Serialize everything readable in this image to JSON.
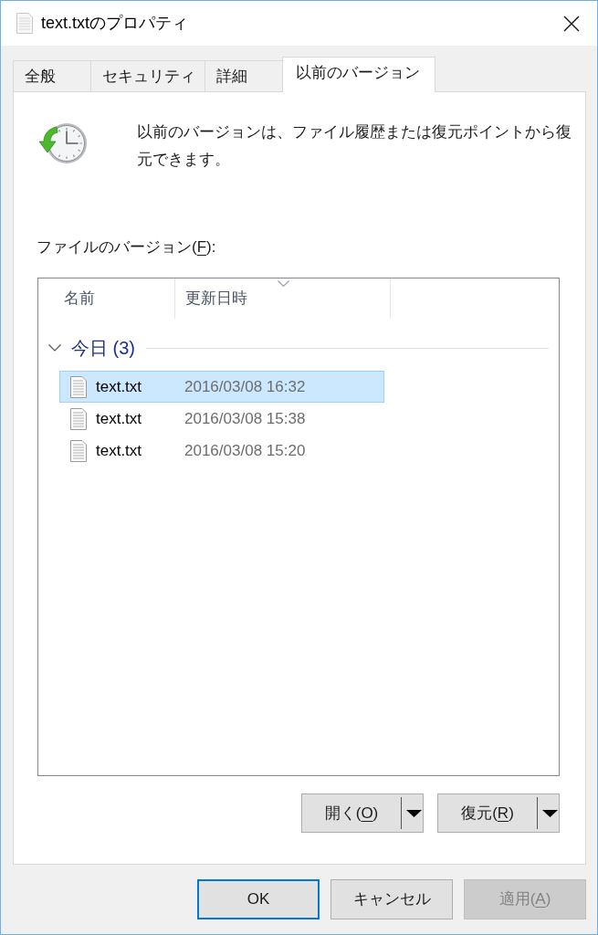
{
  "window": {
    "title": "text.txtのプロパティ"
  },
  "tabs": [
    {
      "label": "全般",
      "selected": false
    },
    {
      "label": "セキュリティ",
      "selected": false
    },
    {
      "label": "詳細",
      "selected": false
    },
    {
      "label": "以前のバージョン",
      "selected": true
    }
  ],
  "description": "以前のバージョンは、ファイル履歴または復元ポイントから復元できます。",
  "versions_label": {
    "before": "ファイルのバージョン(",
    "key": "F",
    "after": "):"
  },
  "list": {
    "columns": [
      {
        "label": "名前",
        "sorted": false
      },
      {
        "label": "更新日時",
        "sorted": true
      }
    ],
    "groups": [
      {
        "label": "今日 (3)",
        "expanded": true,
        "items": [
          {
            "name": "text.txt",
            "modified": "2016/03/08 16:32",
            "selected": true
          },
          {
            "name": "text.txt",
            "modified": "2016/03/08 15:38",
            "selected": false
          },
          {
            "name": "text.txt",
            "modified": "2016/03/08 15:20",
            "selected": false
          }
        ]
      }
    ]
  },
  "list_buttons": [
    {
      "label": {
        "before": "開く(",
        "key": "O",
        "after": ")"
      }
    },
    {
      "label": {
        "before": "復元(",
        "key": "R",
        "after": ")"
      }
    }
  ],
  "dialog_buttons": [
    {
      "label": {
        "before": "OK"
      },
      "default": true,
      "disabled": false
    },
    {
      "label": {
        "before": "キャンセル"
      },
      "default": false,
      "disabled": false
    },
    {
      "label": {
        "before": "適用(",
        "key": "A",
        "after": ")"
      },
      "default": false,
      "disabled": true
    }
  ]
}
